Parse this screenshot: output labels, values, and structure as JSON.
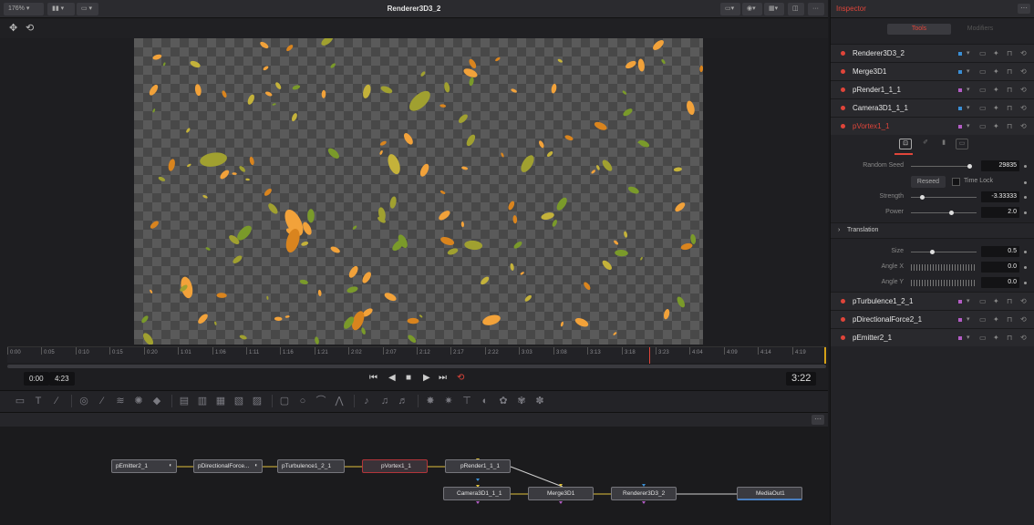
{
  "viewer": {
    "zoom": "176%",
    "title": "Renderer3D3_2",
    "current_time": "0:00",
    "end_time": "4:23",
    "playhead_time": "3:22",
    "ruler_ticks": [
      "0:00",
      "0:05",
      "0:10",
      "0:15",
      "0:20",
      "1:01",
      "1:06",
      "1:11",
      "1:16",
      "1:21",
      "2:02",
      "2:07",
      "2:12",
      "2:17",
      "2:22",
      "3:03",
      "3:08",
      "3:13",
      "3:18",
      "3:23",
      "4:04",
      "4:09",
      "4:14",
      "4:19"
    ]
  },
  "transport": {
    "first_frame": "⏮",
    "prev": "◀",
    "stop": "■",
    "play": "▶",
    "last_frame": "⏭",
    "loop": "⟲"
  },
  "inspector": {
    "title": "Inspector",
    "tabs": {
      "tools": "Tools",
      "modifiers": "Modifiers"
    },
    "tools_top": [
      {
        "name": "Renderer3D3_2",
        "swatch": "#3a8fd6"
      },
      {
        "name": "Merge3D1",
        "swatch": "#3a8fd6"
      },
      {
        "name": "pRender1_1_1",
        "swatch": "#b45dc6"
      },
      {
        "name": "Camera3D1_1_1",
        "swatch": "#3a8fd6"
      },
      {
        "name": "pVortex1_1",
        "swatch": "#b45dc6",
        "active": true
      }
    ],
    "tools_bottom": [
      {
        "name": "pTurbulence1_2_1",
        "swatch": "#b45dc6"
      },
      {
        "name": "pDirectionalForce2_1",
        "swatch": "#b45dc6"
      },
      {
        "name": "pEmitter2_1",
        "swatch": "#b45dc6"
      }
    ],
    "params": {
      "random_seed_label": "Random Seed",
      "random_seed_value": "29835",
      "reseed_label": "Reseed",
      "time_lock_label": "Time Lock",
      "strength_label": "Strength",
      "strength_value": "-3.33333",
      "power_label": "Power",
      "power_value": "2.0",
      "translation_label": "Translation",
      "size_label": "Size",
      "size_value": "0.5",
      "angle_x_label": "Angle X",
      "angle_x_value": "0.0",
      "angle_y_label": "Angle Y",
      "angle_y_value": "0.0"
    }
  },
  "nodes": {
    "emitter": "pEmitter2_1",
    "directional": "pDirectionalForce...",
    "turbulence": "pTurbulence1_2_1",
    "vortex": "pVortex1_1",
    "render": "pRender1_1_1",
    "camera": "Camera3D1_1_1",
    "merge": "Merge3D1",
    "renderer": "Renderer3D3_2",
    "mediaout": "MediaOut1"
  },
  "colors": {
    "accent_red": "#e0453a",
    "leaf_orange": "#f2a23a",
    "leaf_green": "#7a9a2a",
    "link_yellow": "#e2c23a"
  }
}
